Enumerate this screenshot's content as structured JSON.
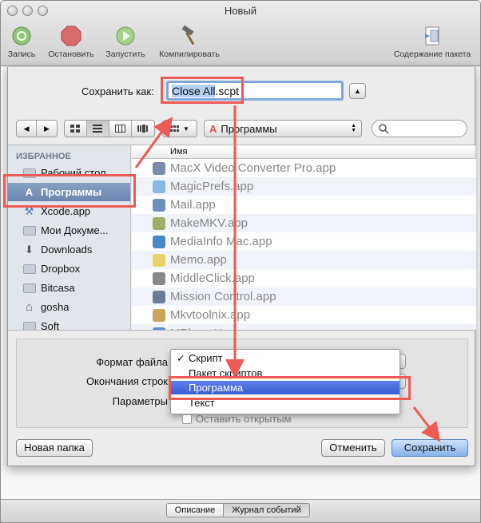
{
  "window": {
    "title": "Новый",
    "toolbar": {
      "record": "Запись",
      "stop": "Остановить",
      "run": "Запустить",
      "compile": "Компилировать",
      "bundle": "Содержание пакета"
    },
    "bottom_tabs": {
      "description": "Описание",
      "event_log": "Журнал событий"
    }
  },
  "save_sheet": {
    "save_as_label": "Сохранить как:",
    "filename_selected": "Close All",
    "filename_ext": ".scpt",
    "location": "Программы",
    "sidebar": {
      "header": "ИЗБРАННОЕ",
      "items": [
        {
          "label": "Рабочий стол",
          "icon": "desktop-folder-icon"
        },
        {
          "label": "Программы",
          "icon": "applications-icon",
          "selected": true
        },
        {
          "label": "Xcode.app",
          "icon": "xcode-icon"
        },
        {
          "label": "Мои Докуме...",
          "icon": "documents-folder-icon"
        },
        {
          "label": "Downloads",
          "icon": "downloads-icon"
        },
        {
          "label": "Dropbox",
          "icon": "folder-icon"
        },
        {
          "label": "Bitcasa",
          "icon": "folder-icon"
        },
        {
          "label": "gosha",
          "icon": "home-icon"
        },
        {
          "label": "Soft",
          "icon": "folder-icon"
        }
      ]
    },
    "file_list": {
      "column_name": "Имя",
      "files": [
        {
          "name": "MacX Video Converter Pro.app",
          "color": "#7a8ca8"
        },
        {
          "name": "MagicPrefs.app",
          "color": "#8ab6e0"
        },
        {
          "name": "Mail.app",
          "color": "#6f8fbf"
        },
        {
          "name": "MakeMKV.app",
          "color": "#9db06a"
        },
        {
          "name": "MediaInfo Mac.app",
          "color": "#4a86c8"
        },
        {
          "name": "Memo.app",
          "color": "#e6d36a"
        },
        {
          "name": "MiddleClick.app",
          "color": "#888888"
        },
        {
          "name": "Mission Control.app",
          "color": "#6b7d96"
        },
        {
          "name": "Mkvtoolnix.app",
          "color": "#c9a560"
        },
        {
          "name": "MPlayerX.app",
          "color": "#5a8fd1"
        }
      ]
    },
    "options": {
      "format_label": "Формат файла",
      "line_endings_label": "Окончания строк",
      "params_label": "Параметры",
      "format_menu": [
        "Скрипт",
        "Пакет скриптов",
        "Программа",
        "Текст"
      ],
      "format_checked_index": 0,
      "format_highlighted_index": 2,
      "keep_open": "Оставить открытым"
    },
    "buttons": {
      "new_folder": "Новая папка",
      "cancel": "Отменить",
      "save": "Сохранить"
    }
  },
  "annotation_color": "#ec5b55"
}
